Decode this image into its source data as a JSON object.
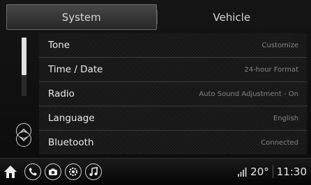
{
  "tabs": [
    {
      "label": "System",
      "active": true
    },
    {
      "label": "Vehicle",
      "active": false
    }
  ],
  "settings": [
    {
      "label": "Tone",
      "value": "Customize"
    },
    {
      "label": "Time / Date",
      "value": "24-hour Format"
    },
    {
      "label": "Radio",
      "value": "Auto Sound Adjustment - On"
    },
    {
      "label": "Language",
      "value": "English"
    },
    {
      "label": "Bluetooth",
      "value": "Connected"
    }
  ],
  "scroll": {
    "position_fraction": 0.0,
    "visible_fraction": 0.64
  },
  "bottom_bar": {
    "icons": [
      "home-icon",
      "phone-icon",
      "camera-icon",
      "settings-icon",
      "music-icon"
    ],
    "temperature": "20°",
    "time": "11:30"
  },
  "colors": {
    "accent": "#e0e0e0",
    "background": "#0b0b0b",
    "value_text": "#858585"
  }
}
